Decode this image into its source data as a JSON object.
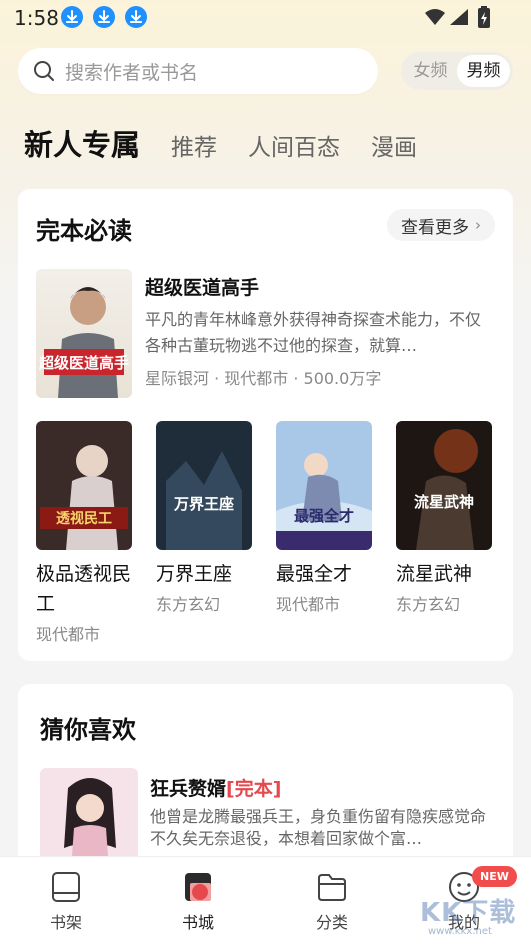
{
  "status_bar": {
    "time": "1:58"
  },
  "search": {
    "placeholder": "搜索作者或书名"
  },
  "gender": {
    "female": "女频",
    "male": "男频",
    "selected": "男频"
  },
  "channels": [
    {
      "label": "新人专属",
      "active": true
    },
    {
      "label": "推荐",
      "active": false
    },
    {
      "label": "人间百态",
      "active": false
    },
    {
      "label": "漫画",
      "active": false
    }
  ],
  "section_complete": {
    "title": "完本必读",
    "more_label": "查看更多",
    "featured": {
      "title": "超级医道高手",
      "description": "平凡的青年林峰意外获得神奇探查术能力，不仅各种古董玩物逃不过他的探查，就算…",
      "meta": "星际银河 · 现代都市 · 500.0万字",
      "cover_text": "超级医道高手"
    },
    "grid": [
      {
        "title": "极品透视民工",
        "category": "现代都市",
        "cover_text": "透视民工"
      },
      {
        "title": "万界王座",
        "category": "东方玄幻",
        "cover_text": "万界王座"
      },
      {
        "title": "最强全才",
        "category": "现代都市",
        "cover_text": "最强全才"
      },
      {
        "title": "流星武神",
        "category": "东方玄幻",
        "cover_text": "流星武神"
      }
    ]
  },
  "section_guess": {
    "title": "猜你喜欢",
    "featured": {
      "title": "狂兵赘婿",
      "tag": "[完本]",
      "description": "他曾是龙腾最强兵王，身负重伤留有隐疾感觉命不久矣无奈退役，本想着回家做个富…"
    }
  },
  "bottom_nav": [
    {
      "label": "书架",
      "icon": "bookshelf-icon",
      "active": false
    },
    {
      "label": "书城",
      "icon": "bookstore-icon",
      "active": true
    },
    {
      "label": "分类",
      "icon": "folder-icon",
      "active": false
    },
    {
      "label": "我的",
      "icon": "profile-icon",
      "active": false
    }
  ],
  "badge": "NEW",
  "watermark": {
    "text": "KK下载",
    "url": "www.kkx.net"
  },
  "colors": {
    "accent_red": "#e5484d",
    "download_blue": "#1e90ff",
    "badge_red": "#f24d4d"
  }
}
